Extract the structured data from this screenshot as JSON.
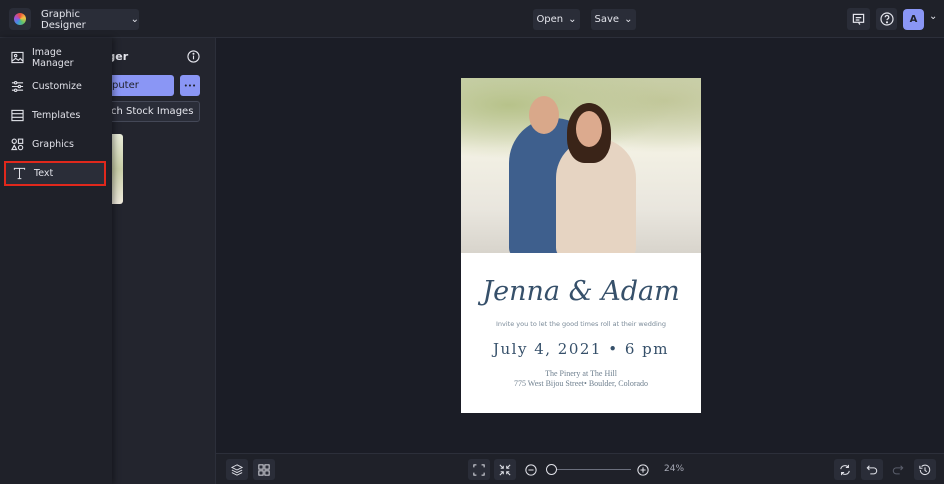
{
  "app": {
    "workspace": "Graphic Designer"
  },
  "header": {
    "open_label": "Open",
    "save_label": "Save",
    "avatar_initial": "A"
  },
  "panel": {
    "title": "Image Manager",
    "title_visible": "ager",
    "upload_label": "puter",
    "more_label": "•••",
    "stock_label": "ch Stock Images"
  },
  "menu": {
    "items": [
      {
        "label": "Image Manager",
        "icon": "image-icon"
      },
      {
        "label": "Customize",
        "icon": "sliders-icon"
      },
      {
        "label": "Templates",
        "icon": "templates-icon"
      },
      {
        "label": "Graphics",
        "icon": "shapes-icon"
      },
      {
        "label": "Text",
        "icon": "text-icon"
      }
    ]
  },
  "document": {
    "names": "Jenna & Adam",
    "invite": "Invite you to let the good times roll at their wedding",
    "date": "July 4, 2021 • 6 pm",
    "venue": "The Pinery at The Hill",
    "address": "775 West Bijou Street• Boulder, Colorado"
  },
  "bottom": {
    "zoom_label": "24%",
    "zoom_percent": 24
  },
  "colors": {
    "accent": "#8a96f5",
    "highlight": "#e0281c",
    "doc_text": "#36506a"
  }
}
